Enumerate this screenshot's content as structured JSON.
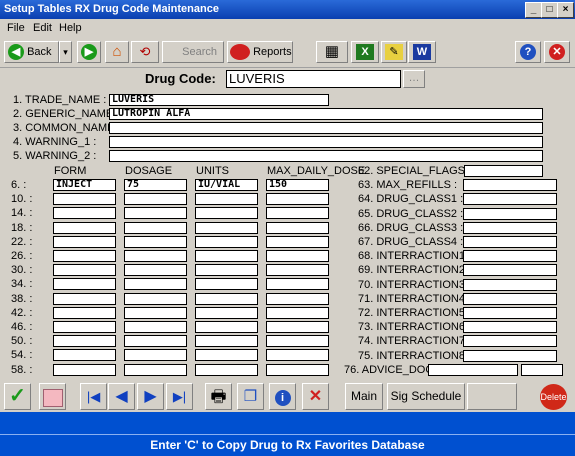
{
  "window": {
    "title": "Setup Tables  RX Drug Code Maintenance",
    "min": "_",
    "max": "□",
    "close": "×"
  },
  "menu": [
    "File",
    "Edit",
    "Help"
  ],
  "toolbar": {
    "back": "Back",
    "back_dd": "▾",
    "search": "Search",
    "reports": "Reports"
  },
  "drug_code": {
    "label": "Drug Code:",
    "value": "LUVERIS",
    "lookup": "…"
  },
  "fields": [
    {
      "label": "1. TRADE_NAME :",
      "value": "LUVERIS"
    },
    {
      "label": "2. GENERIC_NAME :",
      "value": "LUTROPIN ALFA"
    },
    {
      "label": "3. COMMON_NAME :",
      "value": ""
    },
    {
      "label": "4. WARNING_1 :",
      "value": ""
    },
    {
      "label": "5. WARNING_2 :",
      "value": ""
    }
  ],
  "grid": {
    "headers": [
      "FORM",
      "DOSAGE",
      "UNITS",
      "MAX_DAILY_DOSE"
    ],
    "rows": [
      {
        "label": "6.   :",
        "values": [
          "INJECT",
          "75",
          "IU/VIAL",
          "150"
        ]
      },
      {
        "label": "10.  :",
        "values": [
          "",
          "",
          "",
          ""
        ]
      },
      {
        "label": "14.  :",
        "values": [
          "",
          "",
          "",
          ""
        ]
      },
      {
        "label": "18.  :",
        "values": [
          "",
          "",
          "",
          ""
        ]
      },
      {
        "label": "22.  :",
        "values": [
          "",
          "",
          "",
          ""
        ]
      },
      {
        "label": "26.  :",
        "values": [
          "",
          "",
          "",
          ""
        ]
      },
      {
        "label": "30.  :",
        "values": [
          "",
          "",
          "",
          ""
        ]
      },
      {
        "label": "34.  :",
        "values": [
          "",
          "",
          "",
          ""
        ]
      },
      {
        "label": "38.  :",
        "values": [
          "",
          "",
          "",
          ""
        ]
      },
      {
        "label": "42.  :",
        "values": [
          "",
          "",
          "",
          ""
        ]
      },
      {
        "label": "46.  :",
        "values": [
          "",
          "",
          "",
          ""
        ]
      },
      {
        "label": "50.  :",
        "values": [
          "",
          "",
          "",
          ""
        ]
      },
      {
        "label": "54.  :",
        "values": [
          "",
          "",
          "",
          ""
        ]
      },
      {
        "label": "58.  :",
        "values": [
          "",
          "",
          "",
          ""
        ]
      }
    ]
  },
  "right_fields": [
    {
      "label": "62. SPECIAL_FLAGS :",
      "value": ""
    },
    {
      "label": "63. MAX_REFILLS :",
      "value": ""
    },
    {
      "label": "64. DRUG_CLASS1 :",
      "value": ""
    },
    {
      "label": "65. DRUG_CLASS2 :",
      "value": ""
    },
    {
      "label": "66. DRUG_CLASS3 :",
      "value": ""
    },
    {
      "label": "67. DRUG_CLASS4 :",
      "value": ""
    },
    {
      "label": "68. INTERRACTION1 :",
      "value": ""
    },
    {
      "label": "69. INTERRACTION2 :",
      "value": ""
    },
    {
      "label": "70. INTERRACTION3 :",
      "value": ""
    },
    {
      "label": "71. INTERRACTION4 :",
      "value": ""
    },
    {
      "label": "72. INTERRACTION5 :",
      "value": ""
    },
    {
      "label": "73. INTERRACTION6 :",
      "value": ""
    },
    {
      "label": "74. INTERRACTION7 :",
      "value": ""
    },
    {
      "label": "75. INTERRACTION8 :",
      "value": ""
    }
  ],
  "advice_doc": {
    "label": "76. ADVICE_DOC :",
    "value1": "",
    "value2": ""
  },
  "bottom": {
    "check": "✓",
    "first": "|◀",
    "prev": "◀",
    "next": "▶",
    "last": "▶|",
    "info": "i",
    "delete_x": "✕",
    "tab_main": "Main",
    "tab_sig": "Sig Schedule",
    "delete": "Delete"
  },
  "status": {
    "message": "Enter 'C' to Copy Drug to Rx Favorites Database"
  }
}
